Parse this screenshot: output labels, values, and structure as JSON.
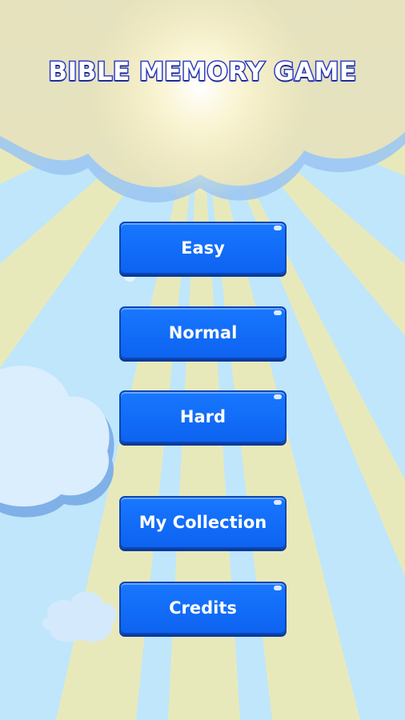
{
  "title": "BIBLE MEMORY GAME",
  "menu": {
    "easy": "Easy",
    "normal": "Normal",
    "hard": "Hard",
    "collection": "My Collection",
    "credits": "Credits"
  },
  "colors": {
    "sky": "#bfe6fb",
    "rays": "#f5e9a8",
    "button": "#1877ff",
    "title_outline": "#2f3fc8"
  }
}
